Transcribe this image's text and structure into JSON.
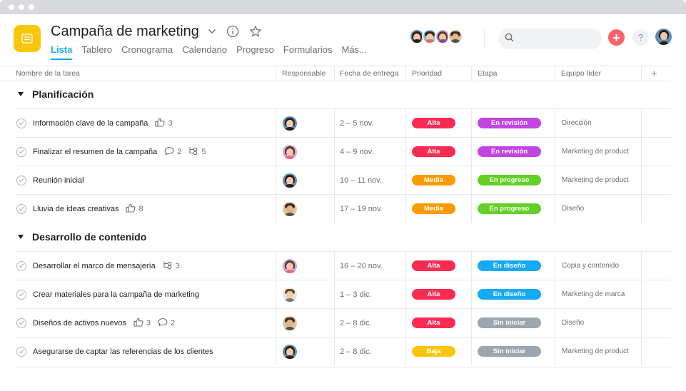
{
  "project": {
    "title": "Campaña de marketing",
    "icon": "list-icon",
    "accent": "#f8c70c",
    "tabs": [
      {
        "label": "Lista",
        "active": true
      },
      {
        "label": "Tablero"
      },
      {
        "label": "Cronograma"
      },
      {
        "label": "Calendario"
      },
      {
        "label": "Progreso"
      },
      {
        "label": "Formularios"
      },
      {
        "label": "Más..."
      }
    ]
  },
  "search": {
    "placeholder": ""
  },
  "help_label": "?",
  "add_label": "+",
  "columns": {
    "task": "Nombre de la tarea",
    "assignee": "Responsable",
    "due": "Fecha de entrega",
    "priority": "Prioridad",
    "stage": "Etapa",
    "team": "Equipo líder",
    "add": "+"
  },
  "colors": {
    "Alta": "#fd2a52",
    "Media": "#fd9a00",
    "Baja": "#f8c70c",
    "En revisión": "#c145e1",
    "En progreso": "#62d026",
    "En diseño": "#14aaf5",
    "Sin iniciar": "#9ca6af"
  },
  "sections": [
    {
      "name": "Planificación",
      "tasks": [
        {
          "name": "Información clave de la campaña",
          "likes": "3",
          "assignee": "woman-dark",
          "due": "2 – 5 nov.",
          "priority": "Alta",
          "stage": "En revisión",
          "team": "Dirección"
        },
        {
          "name": "Finalizar el resumen de la campaña",
          "comments": "2",
          "subtasks": "5",
          "assignee": "woman-pink",
          "due": "4 – 9 nov.",
          "priority": "Alta",
          "stage": "En revisión",
          "team": "Marketing de product"
        },
        {
          "name": "Reunión inicial",
          "assignee": "woman-dark",
          "due": "10 – 11 nov.",
          "priority": "Media",
          "stage": "En progreso",
          "team": "Marketing de product"
        },
        {
          "name": "Lluvia de ideas creativas",
          "likes": "8",
          "assignee": "man-beard",
          "due": "17 – 19 nov.",
          "priority": "Media",
          "stage": "En progreso",
          "team": "Diseño"
        }
      ]
    },
    {
      "name": "Desarrollo de contenido",
      "tasks": [
        {
          "name": "Desarrollar el marco de mensajería",
          "subtasks": "3",
          "assignee": "woman-pink",
          "due": "16 – 20 nov.",
          "priority": "Alta",
          "stage": "En diseño",
          "team": "Copia y contenido"
        },
        {
          "name": "Crear materiales para la campaña de marketing",
          "assignee": "man-light",
          "due": "1 – 3 dic.",
          "priority": "Alta",
          "stage": "En diseño",
          "team": "Marketing de marca"
        },
        {
          "name": "Diseños de activos nuevos",
          "likes": "3",
          "comments": "2",
          "assignee": "man-beard",
          "due": "2 – 8 dic.",
          "priority": "Alta",
          "stage": "Sin iniciar",
          "team": "Diseño"
        },
        {
          "name": "Asegurarse de captar las referencias de los clientes",
          "assignee": "woman-dark",
          "due": "2 – 8 dic.",
          "priority": "Baja",
          "stage": "Sin iniciar",
          "team": "Marketing de product"
        }
      ]
    }
  ]
}
